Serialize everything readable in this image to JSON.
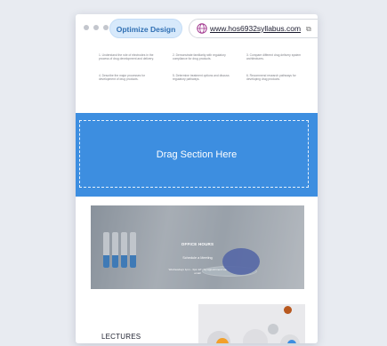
{
  "topbar": {
    "optimize_label": "Optimize Design",
    "url": "www.hos6932syllabus.com"
  },
  "objectives": [
    "1. Understand the role of electrodes in the process of drug development and delivery.",
    "2. Demonstrate familiarity with regulatory compliance for drug products.",
    "3. Compare different drug delivery system architectures.",
    "4. Describe the major processes for development of drug products.",
    "5. Determine treatment options and discuss regulatory pathways.",
    "6. Recommend research pathways for developing drug products."
  ],
  "dropzone": {
    "label": "Drag Section Here"
  },
  "hero": {
    "title": "OFFICE HOURS",
    "subtitle": "Schedule a Meeting",
    "note": "Wednesdays 1pm - 3pm ET / by appointment via email"
  },
  "lectures": {
    "label": "LECTURES"
  },
  "colors": {
    "accent": "#3d8ee0",
    "pill": "#d7e9fb",
    "pill_text": "#2f6fb3",
    "background": "#e8ebf1"
  },
  "icons": [
    "window-dot-icon",
    "globe-icon",
    "external-link-icon"
  ]
}
